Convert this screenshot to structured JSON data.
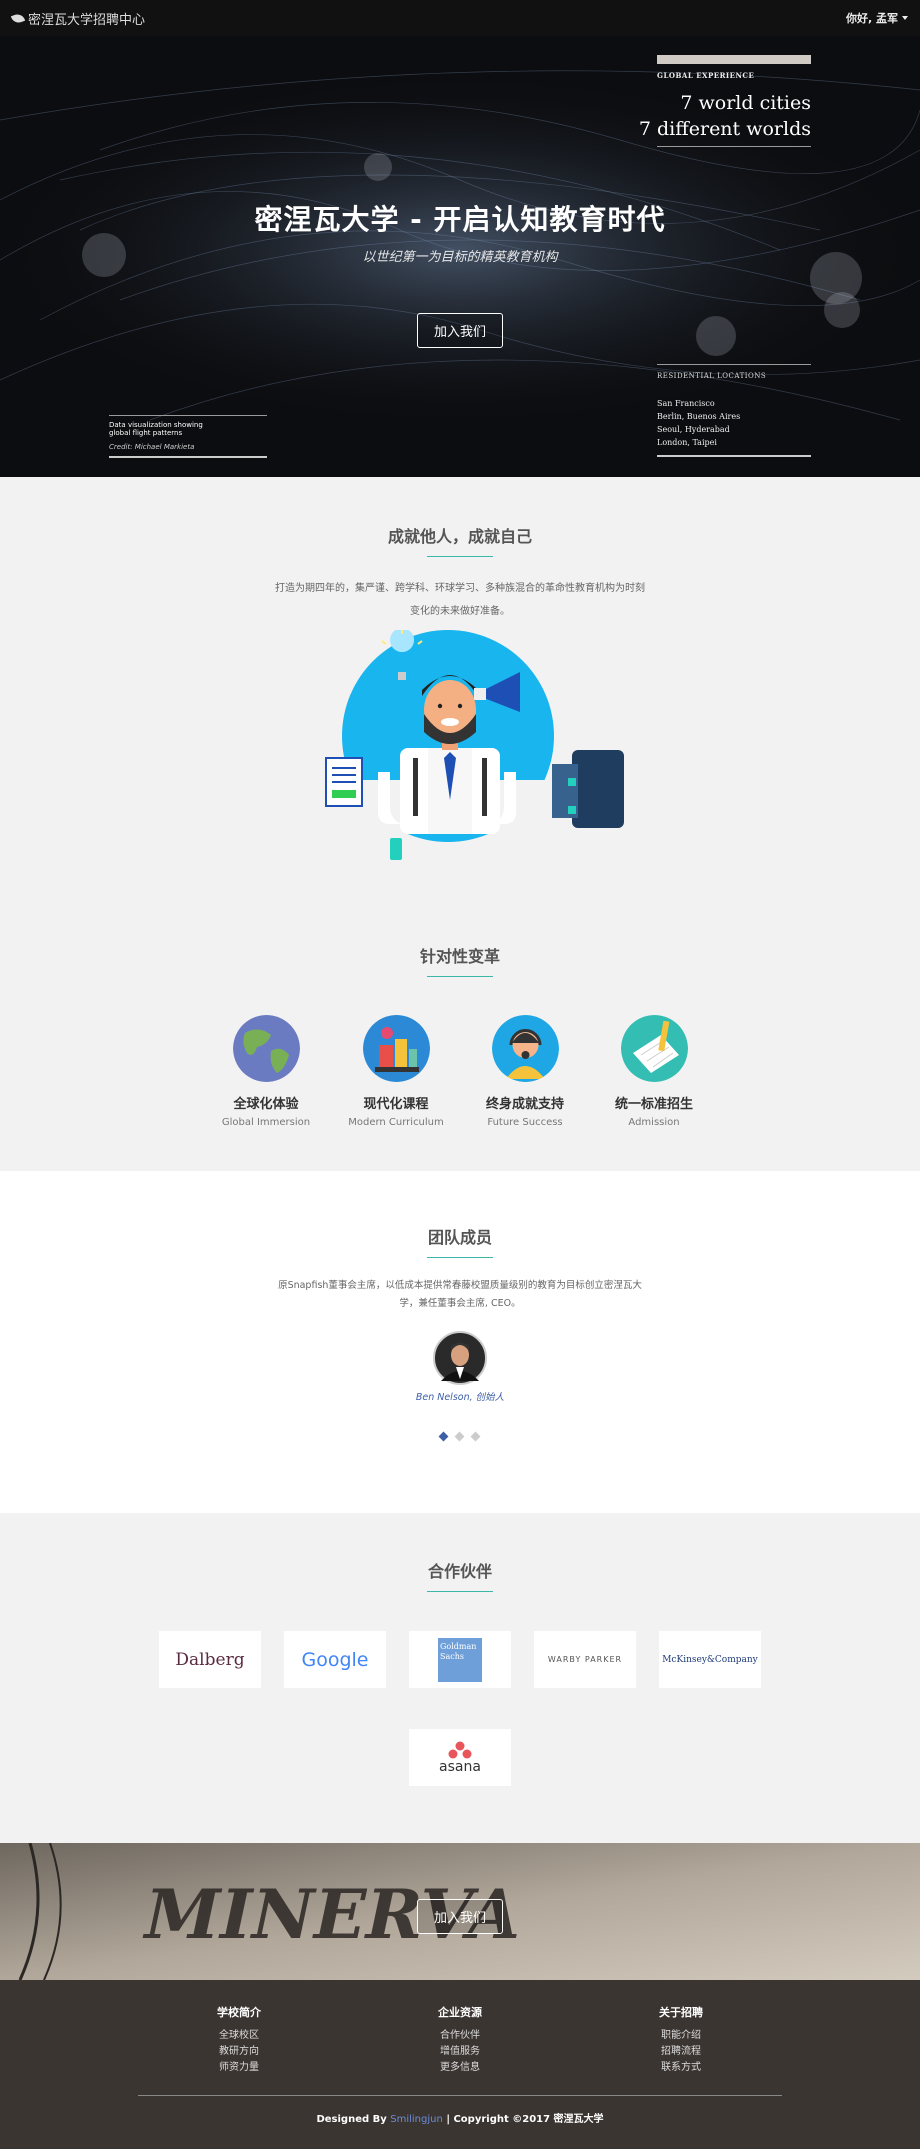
{
  "nav": {
    "brand": "密涅瓦大学招聘中心",
    "user": "你好, 孟军"
  },
  "hero": {
    "title": "密涅瓦大学 - 开启认知教育时代",
    "subtitle": "以世纪第一为目标的精英教育机构",
    "button": "加入我们",
    "global_label": "GLOBAL EXPERIENCE",
    "global_line1": "7 world cities",
    "global_line2": "7 different worlds",
    "residential_label": "RESIDENTIAL LOCATIONS",
    "cities": [
      "San Francisco",
      "Berlin, Buenos Aires",
      "Seoul, Hyderabad",
      "London, Taipei"
    ],
    "dataviz_line1": "Data visualization showing",
    "dataviz_line2": "global flight patterns",
    "credit": "Credit: Michael Markieta"
  },
  "achieve": {
    "title": "成就他人，成就自己",
    "para_line1": "打造为期四年的，集严谨、跨学科、环球学习、多种族混合的革命性教育机构为时刻",
    "para_line2": "变化的未来做好准备。"
  },
  "change": {
    "title": "针对性变革",
    "features": [
      {
        "title": "全球化体验",
        "sub": "Global Immersion",
        "icon": "globe-icon"
      },
      {
        "title": "现代化课程",
        "sub": "Modern Curriculum",
        "icon": "books-icon"
      },
      {
        "title": "终身成就支持",
        "sub": "Future Success",
        "icon": "support-agent-icon"
      },
      {
        "title": "统一标准招生",
        "sub": "Admission",
        "icon": "pencil-paper-icon"
      }
    ]
  },
  "team": {
    "title": "团队成员",
    "para_line1": "原Snapfish董事会主席，以低成本提供常春藤校盟质量级别的教育为目标创立密涅瓦大",
    "para_line2": "学，兼任董事会主席, CEO。",
    "member": "Ben Nelson, 创始人"
  },
  "partners": {
    "title": "合作伙伴",
    "logos": [
      "Dalberg",
      "Google",
      "Goldman Sachs",
      "WARBY PARKER",
      "McKinsey&Company",
      "asana"
    ],
    "goldman_line1": "Goldman",
    "goldman_line2": "Sachs"
  },
  "cta": {
    "button": "加入我们",
    "watermark": "MINERVA"
  },
  "footer": {
    "cols": [
      {
        "title": "学校简介",
        "links": [
          "全球校区",
          "教研方向",
          "师资力量"
        ]
      },
      {
        "title": "企业资源",
        "links": [
          "合作伙伴",
          "增值服务",
          "更多信息"
        ]
      },
      {
        "title": "关于招聘",
        "links": [
          "职能介绍",
          "招聘流程",
          "联系方式"
        ]
      }
    ],
    "designed_by": "Designed By",
    "designer": "Smilingjun",
    "copyright": "| Copyright ©2017 密涅瓦大学"
  }
}
